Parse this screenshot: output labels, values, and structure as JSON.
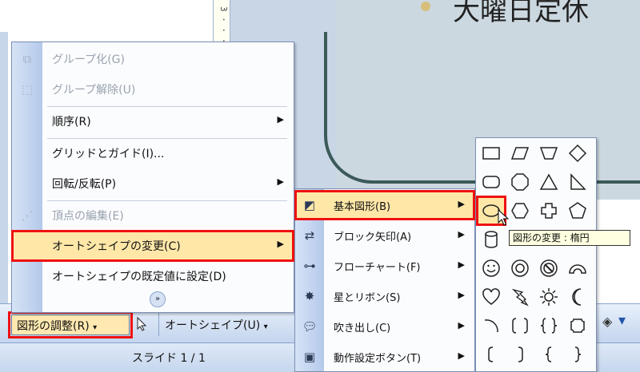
{
  "slide": {
    "title": "大曜日定休",
    "ruler_text": "3 · · · 1 · · ·",
    "accent_color": "#3b5a58"
  },
  "menu": {
    "items": [
      {
        "label": "グループ化(G)",
        "icon": "group-icon",
        "disabled": true
      },
      {
        "label": "グループ解除(U)",
        "icon": "ungroup-icon",
        "disabled": true
      },
      {
        "label": "順序(R)",
        "icon": "",
        "submenu": true
      },
      {
        "label": "グリッドとガイド(I)...",
        "icon": ""
      },
      {
        "label": "回転/反転(P)",
        "icon": "",
        "submenu": true
      },
      {
        "label": "頂点の編集(E)",
        "icon": "edit-points-icon",
        "disabled": true
      },
      {
        "label": "オートシェイプの変更(C)",
        "icon": "",
        "submenu": true,
        "highlighted": true
      },
      {
        "label": "オートシェイプの既定値に設定(D)",
        "icon": ""
      }
    ],
    "expand_icon": "double-chevron-down-icon"
  },
  "submenu": {
    "items": [
      {
        "label": "基本図形(B)",
        "icon": "basic-shapes-icon",
        "highlighted": true
      },
      {
        "label": "ブロック矢印(A)",
        "icon": "block-arrows-icon"
      },
      {
        "label": "フローチャート(F)",
        "icon": "flowchart-icon"
      },
      {
        "label": "星とリボン(S)",
        "icon": "stars-ribbons-icon"
      },
      {
        "label": "吹き出し(C)",
        "icon": "callouts-icon"
      },
      {
        "label": "動作設定ボタン(T)",
        "icon": "action-buttons-icon"
      }
    ]
  },
  "palette": {
    "tooltip": "図形の変更 : 楕円",
    "selected": "oval"
  },
  "toolbar": {
    "draw_label": "図形の調整(R)",
    "autoshape_label": "オートシェイプ(U)",
    "highlight_color": "#ee1111"
  },
  "status": {
    "slide_label": "スライド 1 / 1"
  }
}
